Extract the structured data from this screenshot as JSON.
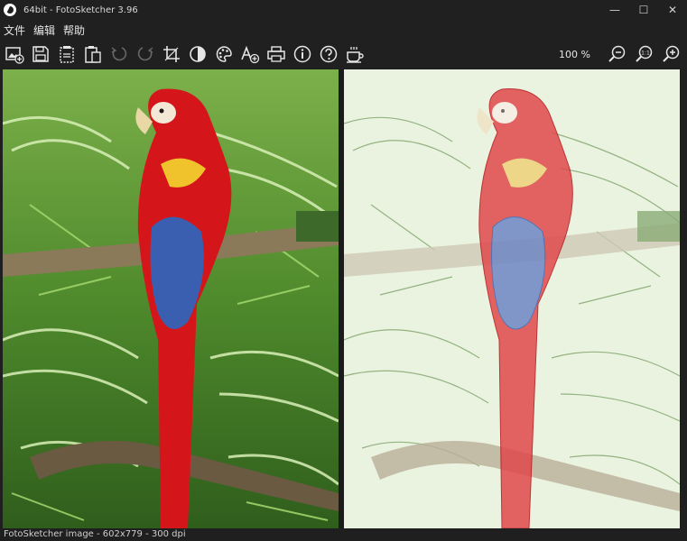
{
  "window": {
    "title": "64bit - FotoSketcher 3.96",
    "minimize_label": "—",
    "maximize_label": "☐",
    "close_label": "✕"
  },
  "menu": {
    "items": [
      "文件",
      "编辑",
      "帮助"
    ]
  },
  "toolbar": {
    "icons": [
      "open-image-icon",
      "save-icon",
      "copy-icon",
      "paste-icon",
      "undo-icon",
      "redo-icon",
      "crop-icon",
      "contrast-icon",
      "palette-icon",
      "add-text-icon",
      "print-icon",
      "info-icon",
      "help-icon",
      "coffee-icon"
    ],
    "zoom_level": "100 %",
    "zoom_icons": [
      "zoom-out-icon",
      "zoom-actual-size-icon",
      "zoom-in-icon"
    ],
    "zoom_actual_label": "1:1"
  },
  "status": {
    "text": "FotoSketcher image - 602x779 - 300 dpi"
  },
  "colors": {
    "background": "#1f1f1f",
    "parrot_red": "#d4161b",
    "parrot_blue": "#3a5fb0",
    "foliage_green": "#5e9a3a",
    "sketch_background": "#eaf3e0"
  }
}
